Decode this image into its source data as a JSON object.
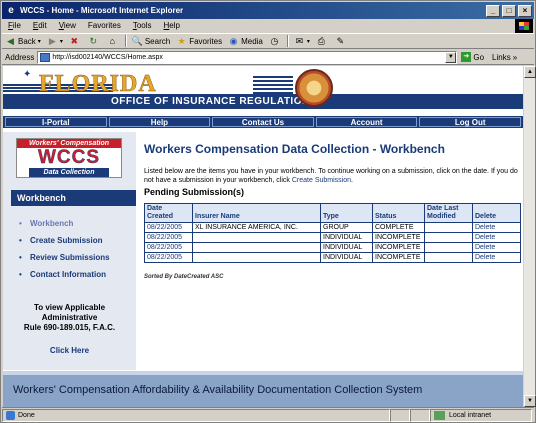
{
  "window": {
    "title": "WCCS - Home - Microsoft Internet Explorer"
  },
  "menu": [
    {
      "label": "File",
      "ul": "F",
      "rest": "ile"
    },
    {
      "label": "Edit",
      "ul": "E",
      "rest": "dit"
    },
    {
      "label": "View",
      "ul": "V",
      "rest": "iew"
    },
    {
      "label": "Favorites",
      "ul": "F",
      "rest": "avorites",
      "pre": ""
    },
    {
      "label": "Tools",
      "ul": "T",
      "rest": "ools"
    },
    {
      "label": "Help",
      "ul": "H",
      "rest": "elp"
    }
  ],
  "toolbar": {
    "back": "Back",
    "search": "Search",
    "favorites": "Favorites",
    "media": "Media"
  },
  "address": {
    "label": "Address",
    "url": "http://isd002140/WCCS/Home.aspx",
    "go": "Go",
    "links": "Links"
  },
  "banner": {
    "state": "FLORIDA",
    "office": "OFFICE OF INSURANCE REGULATION"
  },
  "nav": [
    "I-Portal",
    "Help",
    "Contact Us",
    "Account",
    "Log Out"
  ],
  "logo": {
    "top": "Workers' Compensation",
    "main": "WCCS",
    "bottom": "Data Collection"
  },
  "sidebar": {
    "heading": "Workbench",
    "items": [
      "Workbench",
      "Create Submission",
      "Review Submissions",
      "Contact Information"
    ],
    "rule_line1": "To view Applicable",
    "rule_line2": "Administrative",
    "rule_line3": "Rule 690-189.015, F.A.C.",
    "click_here": "Click Here"
  },
  "main": {
    "title": "Workers Compensation Data Collection - Workbench",
    "intro_part1": "Listed below are the items you have in your workbench. To continue working on a submission, click on the date. If you do not have a submission in your workbench, click",
    "intro_link": "Create Submission",
    "intro_end": ".",
    "pending_heading": "Pending Submission(s)",
    "sort_note": "Sorted By DateCreated ASC"
  },
  "table": {
    "headers": [
      "Date Created",
      "Insurer Name",
      "Type",
      "Status",
      "Date Last Modified",
      "Delete"
    ],
    "rows": [
      {
        "date": "08/22/2005",
        "insurer": "XL INSURANCE AMERICA, INC.",
        "type": "GROUP",
        "status": "COMPLETE",
        "modified": "",
        "delete": "Delete"
      },
      {
        "date": "08/22/2005",
        "insurer": "",
        "type": "INDIVIDUAL",
        "status": "INCOMPLETE",
        "modified": "",
        "delete": "Delete"
      },
      {
        "date": "08/22/2005",
        "insurer": "",
        "type": "INDIVIDUAL",
        "status": "INCOMPLETE",
        "modified": "",
        "delete": "Delete"
      },
      {
        "date": "08/22/2005",
        "insurer": "",
        "type": "INDIVIDUAL",
        "status": "INCOMPLETE",
        "modified": "",
        "delete": "Delete"
      }
    ]
  },
  "footer": {
    "text": "Workers' Compensation Affordability & Availability Documentation Collection System"
  },
  "status": {
    "left": "Done",
    "zone": "Local intranet"
  },
  "colors": {
    "navy": "#1a3a78",
    "red": "#c8202a",
    "gold": "#e8a72a",
    "footer": "#8aa4c8"
  }
}
